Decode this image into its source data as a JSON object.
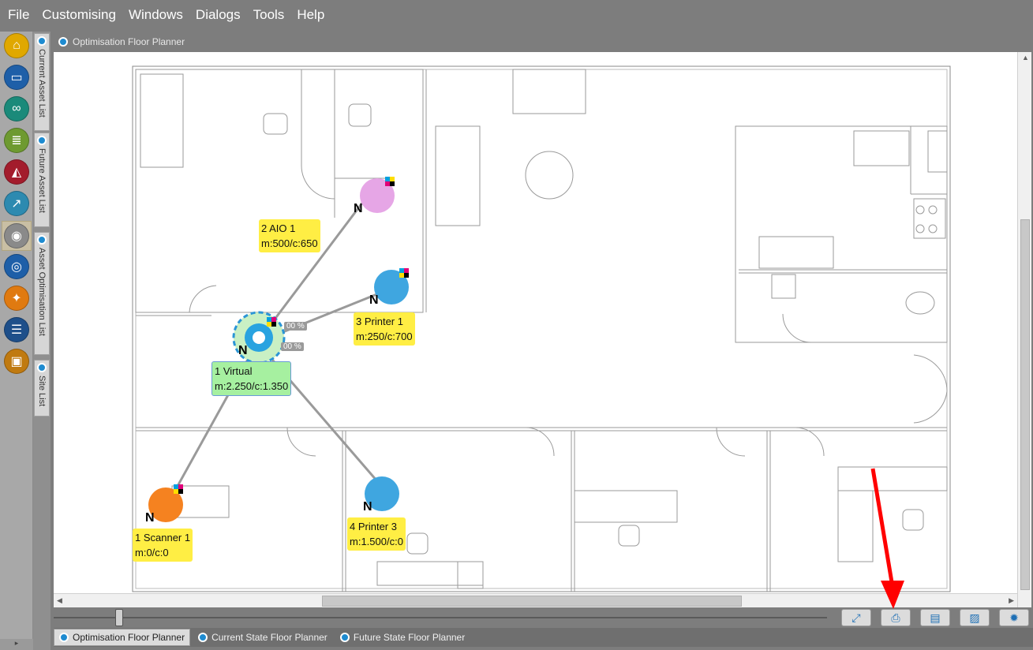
{
  "menu": [
    "File",
    "Customising",
    "Windows",
    "Dialogs",
    "Tools",
    "Help"
  ],
  "left_rail": {
    "buttons": [
      {
        "name": "home-icon",
        "color": "#e0a800",
        "glyph": "⌂"
      },
      {
        "name": "folder-icon",
        "color": "#1e5fa8",
        "glyph": "▭"
      },
      {
        "name": "binoculars-icon",
        "color": "#1b8a7a",
        "glyph": "∞"
      },
      {
        "name": "scroll-icon",
        "color": "#6e9a30",
        "glyph": "≣"
      },
      {
        "name": "area-chart-icon",
        "color": "#a31c2c",
        "glyph": "◭"
      },
      {
        "name": "trend-icon",
        "color": "#2d8ab0",
        "glyph": "↗"
      },
      {
        "name": "eye-icon",
        "color": "#8a8a8a",
        "glyph": "◉"
      },
      {
        "name": "target-icon",
        "color": "#1e5fa8",
        "glyph": "◎"
      },
      {
        "name": "handshake-icon",
        "color": "#e07a10",
        "glyph": "✦"
      },
      {
        "name": "document-list-icon",
        "color": "#1e4f8a",
        "glyph": "☰"
      },
      {
        "name": "briefcase-icon",
        "color": "#c07a10",
        "glyph": "▣"
      }
    ]
  },
  "vertical_tabs": [
    "Current Asset List",
    "Future Asset List",
    "Asset Optimisation List",
    "Site List"
  ],
  "document": {
    "title": "Optimisation Floor Planner"
  },
  "devices": [
    {
      "id": "aio",
      "label1": "2 AIO 1",
      "label2": "m:500/c:650",
      "icon": "aio-icon",
      "color": "#e6a6e6"
    },
    {
      "id": "printer1",
      "label1": "3 Printer 1",
      "label2": "m:250/c:700",
      "icon": "printer-icon",
      "color": "#3fa6e0"
    },
    {
      "id": "virtual",
      "label1": "1 Virtual",
      "label2": "m:2.250/c:1.350",
      "icon": "virtual-hub-icon",
      "color": "#29a3e0"
    },
    {
      "id": "scanner",
      "label1": "1 Scanner 1",
      "label2": "m:0/c:0",
      "icon": "scanner-icon",
      "color": "#f58220"
    },
    {
      "id": "printer3",
      "label1": "4 Printer 3",
      "label2": "m:1.500/c:0",
      "icon": "printer-icon",
      "color": "#3fa6e0"
    }
  ],
  "percent_badges": [
    "00 %",
    "00 %"
  ],
  "n_mark": "N",
  "toolbar_buttons": [
    {
      "name": "expand-button",
      "glyph": "⤢"
    },
    {
      "name": "print-button",
      "glyph": "⎙"
    },
    {
      "name": "save-button",
      "glyph": "▤"
    },
    {
      "name": "image-export-button",
      "glyph": "▨"
    },
    {
      "name": "settings-button",
      "glyph": "✹"
    }
  ],
  "bottom_tabs": [
    "Optimisation Floor Planner",
    "Current State Floor Planner",
    "Future State Floor Planner"
  ],
  "accent": "#1e8bd0",
  "arrow_color": "#ff0000"
}
